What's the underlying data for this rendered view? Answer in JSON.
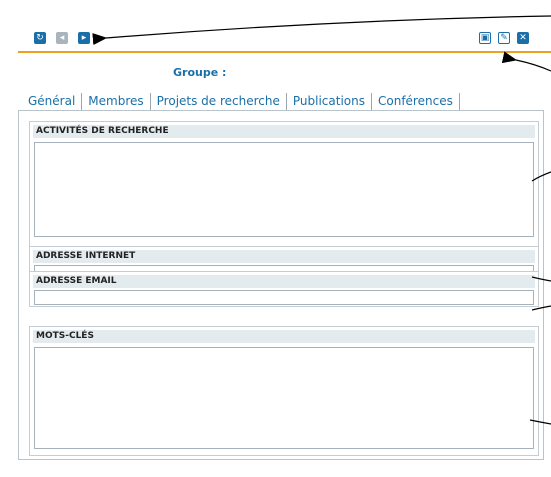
{
  "toolbar": {
    "nav_icons": [
      "refresh-icon",
      "previous-icon",
      "next-icon"
    ],
    "action_icons": [
      "save-icon",
      "edit-icon",
      "close-icon"
    ]
  },
  "header": {
    "group_label": "Groupe :",
    "group_value": ""
  },
  "tabs": [
    {
      "label": "Général"
    },
    {
      "label": "Membres"
    },
    {
      "label": "Projets de recherche"
    },
    {
      "label": "Publications"
    },
    {
      "label": "Conférences"
    }
  ],
  "sections": {
    "research": {
      "title": "ACTIVITÉS DE RECHERCHE",
      "value": ""
    },
    "website": {
      "title": "ADRESSE INTERNET",
      "value": ""
    },
    "email": {
      "title": "ADRESSE EMAIL",
      "value": ""
    },
    "keywords": {
      "title": "MOTS-CLÉS",
      "value": ""
    }
  },
  "colors": {
    "accent": "#1b6fa8",
    "separator": "#f0a020",
    "section_header": "#e4ebef"
  }
}
